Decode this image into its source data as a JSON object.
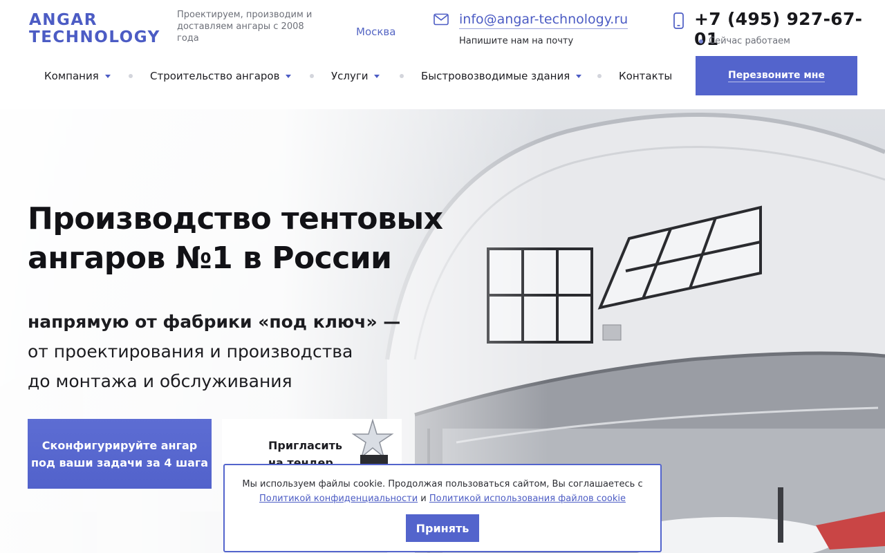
{
  "header": {
    "logo_line1": "ANGAR",
    "logo_line2": "TECHNOLOGY",
    "tagline": "Проектируем, производим и доставляем ангары с 2008 года",
    "city": "Москва",
    "email": "info@angar-technology.ru",
    "email_note": "Напишите нам на почту",
    "phone": "+7 (495) 927-67-01",
    "status": "Сейчас работаем",
    "callback_label": "Перезвоните мне"
  },
  "nav": {
    "items": [
      {
        "label": "Компания",
        "dropdown": true
      },
      {
        "label": "Строительство ангаров",
        "dropdown": true
      },
      {
        "label": "Услуги",
        "dropdown": true
      },
      {
        "label": "Быстровозводимые здания",
        "dropdown": true
      },
      {
        "label": "Контакты",
        "dropdown": false
      }
    ]
  },
  "hero": {
    "title_line1": "Производство тентовых",
    "title_line2": "ангаров №1 в России",
    "sub_bold": "напрямую от фабрики «под ключ» —",
    "sub_line2": "от проектирования и производства",
    "sub_line3": "до монтажа и обслуживания",
    "configure_line1": "Сконфигурируйте ангар",
    "configure_line2": "под ваши задачи за 4 шага",
    "tender_line1": "Пригласить",
    "tender_line2": "на тендер"
  },
  "cookie": {
    "text": "Мы используем файлы cookie. Продолжая пользоваться сайтом, Вы соглашаетесь с",
    "privacy_link": "Политикой конфиденциальности",
    "and": "и",
    "cookie_link": "Политикой использования файлов cookie",
    "accept_label": "Принять"
  },
  "colors": {
    "accent": "#5364cc",
    "logo": "#4c5cc4",
    "text": "#1b1b1f"
  },
  "icons": [
    "mail-icon",
    "phone-icon",
    "chevron-down-icon",
    "award-icon"
  ]
}
